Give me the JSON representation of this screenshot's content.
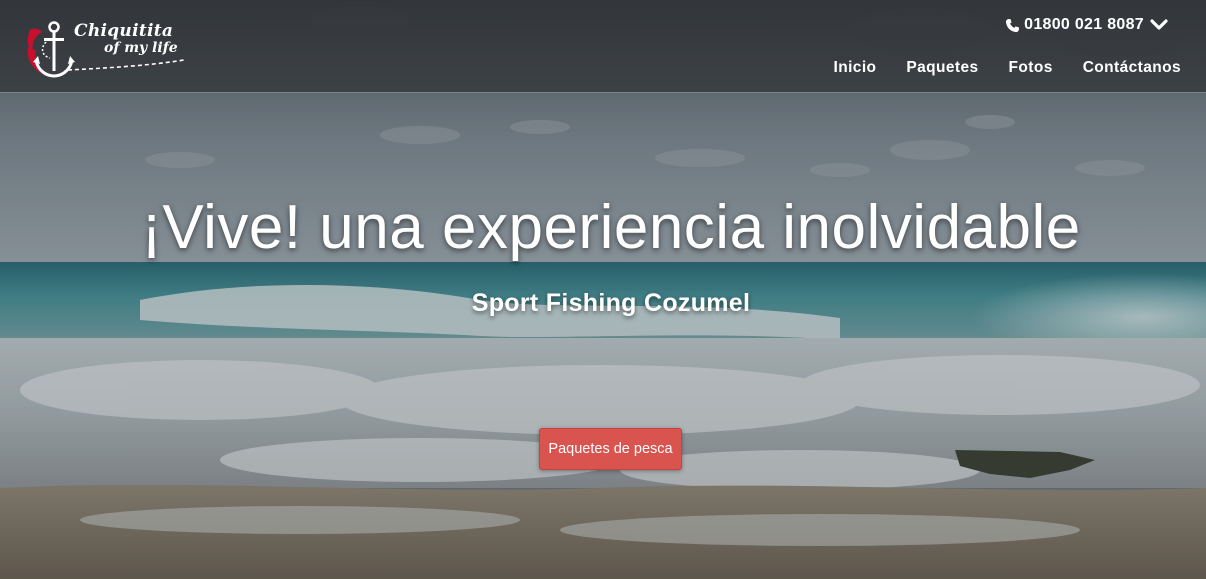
{
  "brand": {
    "line1": "Chiquitita",
    "line2": "of my life",
    "accent_color": "#c8102e"
  },
  "header": {
    "phone": "01800 021 8087",
    "phone_icon": "phone-icon",
    "dropdown_icon": "chevron-down-icon"
  },
  "nav": {
    "items": [
      {
        "label": "Inicio"
      },
      {
        "label": "Paquetes"
      },
      {
        "label": "Fotos"
      },
      {
        "label": "Contáctanos"
      }
    ]
  },
  "hero": {
    "title": "¡Vive! una experiencia inolvidable",
    "subtitle": "Sport Fishing Cozumel",
    "cta_label": "Paquetes de pesca",
    "cta_color": "#d9534f"
  }
}
